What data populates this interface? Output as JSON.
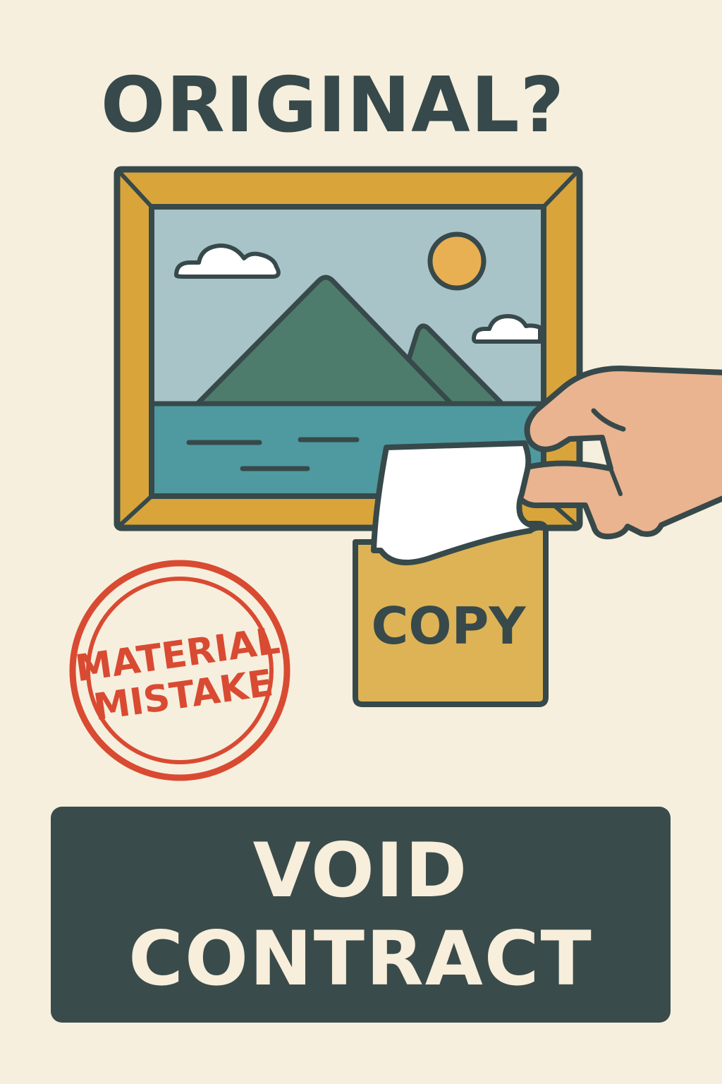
{
  "headline": "ORIGINAL?",
  "copy_label": "COPY",
  "stamp": {
    "line1": "MATERIAL",
    "line2": "MISTAKE"
  },
  "banner": {
    "line1": "VOID",
    "line2": "CONTRACT"
  },
  "colors": {
    "background": "#f6efdd",
    "outline": "#37494a",
    "frame": "#d9a53a",
    "sky": "#a8c4c8",
    "mountain": "#4e7c6c",
    "water": "#4e9aa0",
    "sun": "#e8b053",
    "hand": "#e9b48f",
    "copy_sleeve": "#ddb355",
    "stamp_red": "#d94a32",
    "banner": "#3a4b4b",
    "banner_text": "#f7eedb"
  },
  "icons": [
    "picture-frame-icon",
    "hand-icon",
    "copy-document-icon",
    "stamp-icon"
  ]
}
